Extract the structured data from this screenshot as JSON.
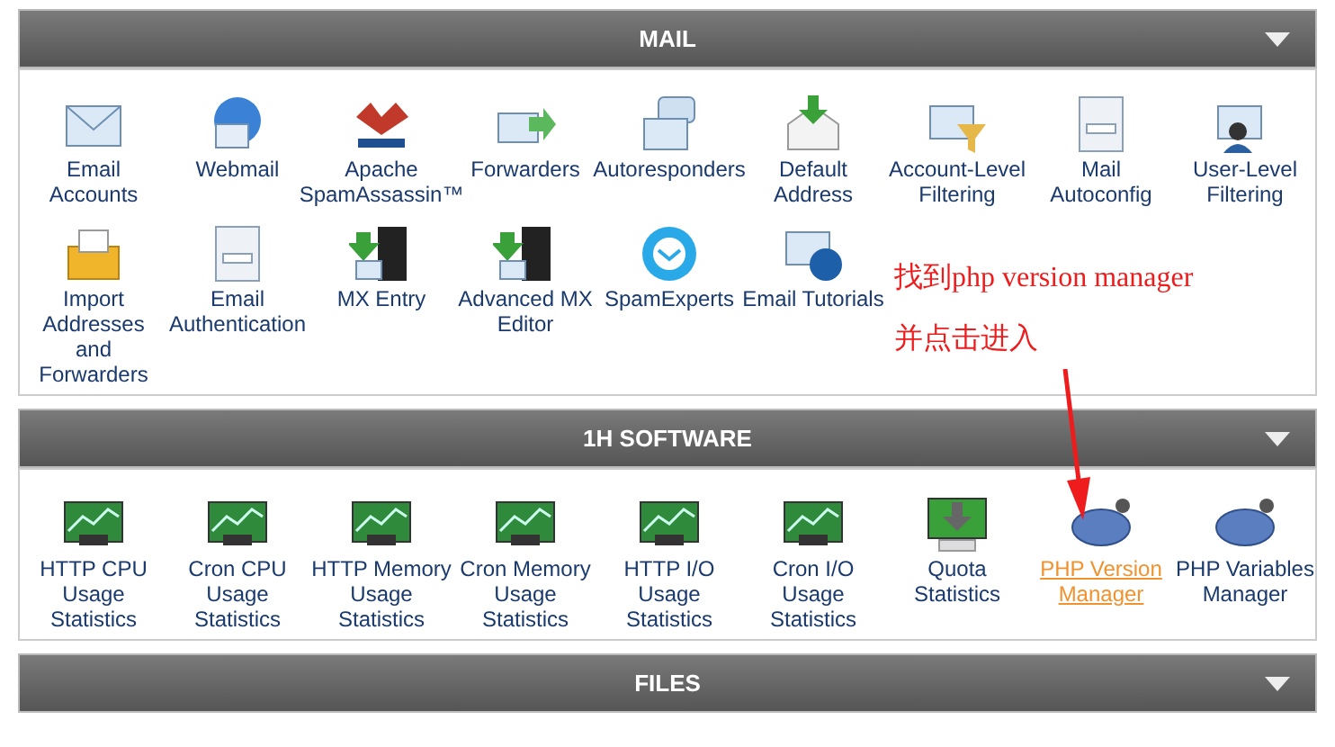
{
  "sections": [
    {
      "title": "MAIL",
      "expanded": true,
      "items": [
        {
          "label": "Email Accounts",
          "selected": false
        },
        {
          "label": "Webmail",
          "selected": false
        },
        {
          "label": "Apache SpamAssassin™",
          "selected": false
        },
        {
          "label": "Forwarders",
          "selected": false
        },
        {
          "label": "Autoresponders",
          "selected": false
        },
        {
          "label": "Default Address",
          "selected": false
        },
        {
          "label": "Account-Level Filtering",
          "selected": false
        },
        {
          "label": "Mail Autoconfig",
          "selected": false
        },
        {
          "label": "User-Level Filtering",
          "selected": false
        },
        {
          "label": "Import Addresses and Forwarders",
          "selected": false
        },
        {
          "label": "Email Authentication",
          "selected": false
        },
        {
          "label": "MX Entry",
          "selected": false
        },
        {
          "label": "Advanced MX Editor",
          "selected": false
        },
        {
          "label": "SpamExperts",
          "selected": false
        },
        {
          "label": "Email Tutorials",
          "selected": false
        }
      ]
    },
    {
      "title": "1H SOFTWARE",
      "expanded": true,
      "items": [
        {
          "label": "HTTP CPU Usage Statistics",
          "selected": false
        },
        {
          "label": "Cron CPU Usage Statistics",
          "selected": false
        },
        {
          "label": "HTTP Memory Usage Statistics",
          "selected": false
        },
        {
          "label": "Cron Memory Usage Statistics",
          "selected": false
        },
        {
          "label": "HTTP I/O Usage Statistics",
          "selected": false
        },
        {
          "label": "Cron I/O Usage Statistics",
          "selected": false
        },
        {
          "label": "Quota Statistics",
          "selected": false
        },
        {
          "label": "PHP Version Manager",
          "selected": true
        },
        {
          "label": "PHP Variables Manager",
          "selected": false
        }
      ]
    },
    {
      "title": "FILES",
      "expanded": true
    }
  ],
  "annotation": {
    "lines": [
      "找到php version manager",
      "并点击进入"
    ]
  }
}
